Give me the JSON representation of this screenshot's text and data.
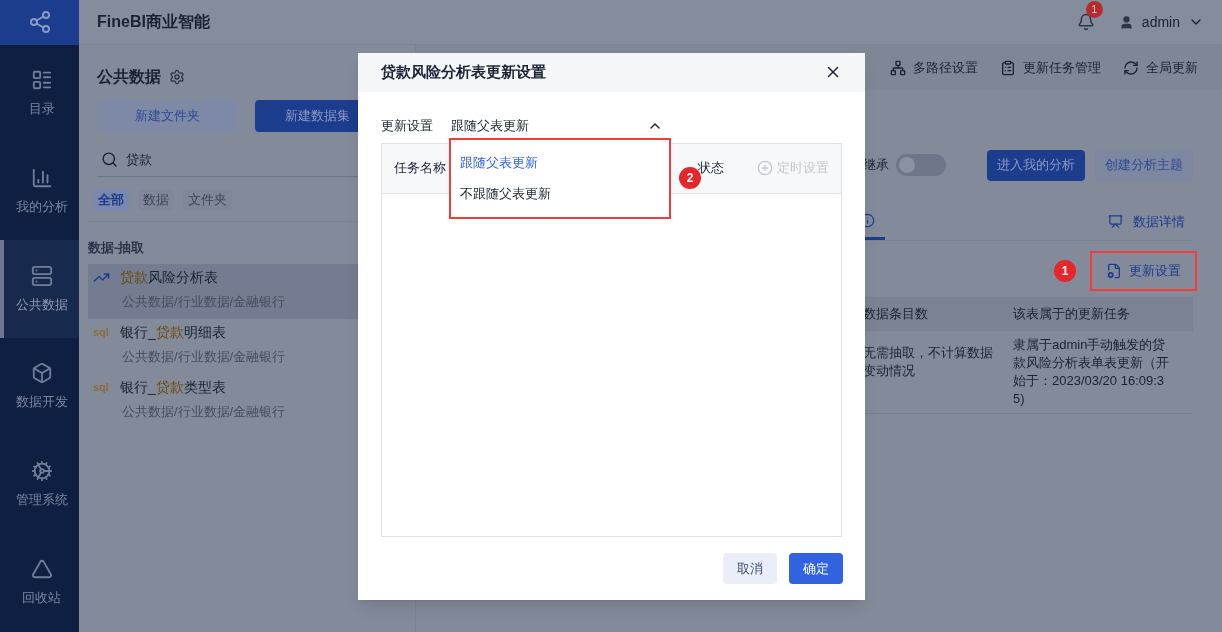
{
  "app": {
    "title": "FineBI商业智能",
    "notification_count": "1",
    "user": "admin"
  },
  "nav": [
    {
      "label": "目录",
      "kind": "catalog",
      "selected": false
    },
    {
      "label": "我的分析",
      "kind": "analysis",
      "selected": false
    },
    {
      "label": "公共数据",
      "kind": "public",
      "selected": true
    },
    {
      "label": "数据开发",
      "kind": "develop",
      "selected": false
    },
    {
      "label": "管理系统",
      "kind": "manage",
      "selected": false
    },
    {
      "label": "回收站",
      "kind": "recycle",
      "selected": false
    }
  ],
  "panel": {
    "title": "公共数据",
    "buttons": [
      "新建文件夹",
      "新建数据集"
    ],
    "search": {
      "value": "贷款"
    },
    "filters": [
      {
        "label": "全部",
        "selected": true
      },
      {
        "label": "数据",
        "selected": false
      },
      {
        "label": "文件夹",
        "selected": false
      }
    ],
    "section": "数据-抽取",
    "items": [
      {
        "kind": "line",
        "match": "贷款",
        "suffix": "风险分析表",
        "path": "公共数据/行业数据/金融银行",
        "selected": true
      },
      {
        "kind": "sql",
        "type_label": "sql",
        "prefix": "银行_",
        "match": "贷款",
        "suffix": "明细表",
        "path": "公共数据/行业数据/金融银行",
        "selected": false
      },
      {
        "kind": "sql",
        "type_label": "sql",
        "prefix": "银行_",
        "match": "贷款",
        "suffix": "类型表",
        "path": "公共数据/行业数据/金融银行",
        "selected": false
      }
    ]
  },
  "toolbar": [
    {
      "kind": "multipath",
      "label": "多路径设置"
    },
    {
      "kind": "tasks",
      "label": "更新任务管理"
    },
    {
      "kind": "global",
      "label": "全局更新"
    }
  ],
  "main": {
    "inherit": {
      "label": "继承",
      "on": false
    },
    "buttons": [
      {
        "label": "进入我的分析",
        "primary": true
      },
      {
        "label": "创建分析主题",
        "primary": false
      }
    ],
    "detail_tab": "数据详情",
    "marker_1": "1",
    "update_button": "更新设置",
    "table": {
      "columns": [
        "数据条目数",
        "该表属于的更新任务"
      ],
      "rows": [
        [
          "无需抽取，不计算数据变动情况",
          "隶属于admin手动触发的贷款风险分析表单表更新（开始于：2023/03/20 16:09:35)"
        ]
      ]
    }
  },
  "dialog": {
    "title": "贷款风险分析表更新设置",
    "field_label": "更新设置",
    "value": "跟随父表更新",
    "expanded": true,
    "options": [
      {
        "label": "跟随父表更新",
        "selected": true
      },
      {
        "label": "不跟随父表更新",
        "selected": false
      }
    ],
    "marker_2": "2",
    "table": {
      "columns": [
        "任务名称",
        "状态"
      ],
      "action": "定时设置"
    },
    "buttons": [
      {
        "label": "取消",
        "primary": false
      },
      {
        "label": "确定",
        "primary": true
      }
    ]
  }
}
